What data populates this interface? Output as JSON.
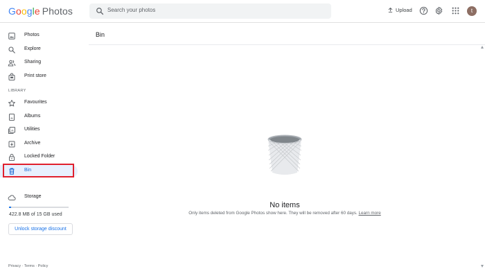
{
  "app": {
    "logo_word": "Google",
    "logo_product": "Photos"
  },
  "header": {
    "search_placeholder": "Search your photos",
    "upload_label": "Upload",
    "avatar_initial": "t"
  },
  "sidebar": {
    "items_top": [
      {
        "label": "Photos",
        "icon": "photo-icon"
      },
      {
        "label": "Explore",
        "icon": "search-icon"
      },
      {
        "label": "Sharing",
        "icon": "people-icon"
      },
      {
        "label": "Print store",
        "icon": "bag-icon"
      }
    ],
    "library_label": "LIBRARY",
    "items_library": [
      {
        "label": "Favourites",
        "icon": "star-icon"
      },
      {
        "label": "Albums",
        "icon": "album-icon"
      },
      {
        "label": "Utilities",
        "icon": "utilities-icon"
      },
      {
        "label": "Archive",
        "icon": "archive-icon"
      },
      {
        "label": "Locked Folder",
        "icon": "lock-icon"
      },
      {
        "label": "Bin",
        "icon": "trash-icon",
        "active": true
      }
    ],
    "storage": {
      "label": "Storage",
      "used_text": "422.8 MB of 15 GB used",
      "used_fraction": 0.028,
      "unlock_button": "Unlock storage discount"
    },
    "footer": {
      "privacy": "Privacy",
      "terms": "Terms",
      "policy": "Policy",
      "separator": "·"
    }
  },
  "main": {
    "title": "Bin",
    "empty_title": "No items",
    "empty_description": "Only items deleted from Google Photos show here. They will be removed after 60 days.",
    "learn_more": "Learn more"
  },
  "colors": {
    "accent": "#1a73e8",
    "active_bg": "#e8f0fe",
    "highlight_border": "#e0202d"
  }
}
